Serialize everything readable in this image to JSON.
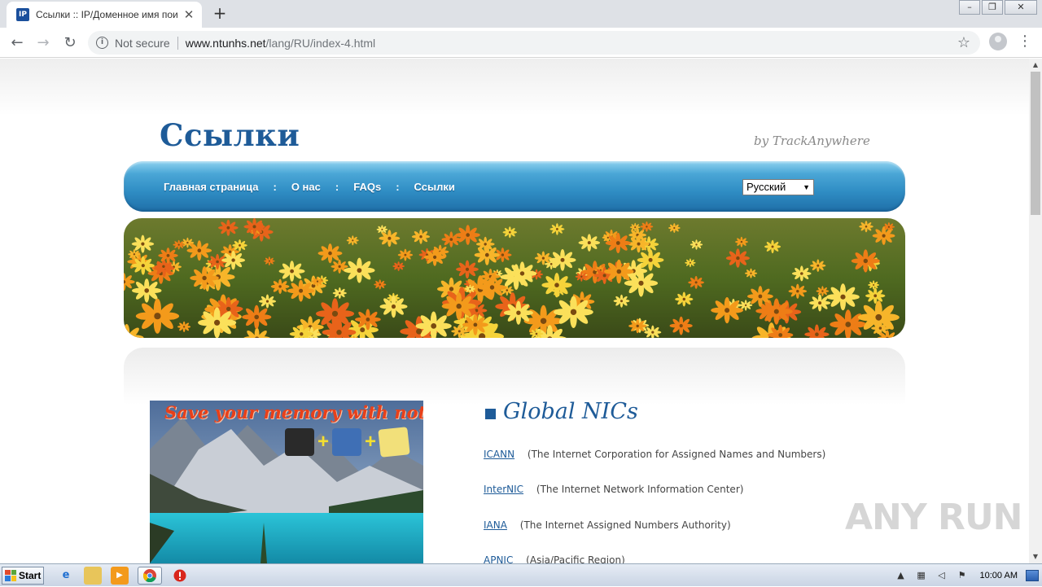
{
  "browser": {
    "tab_title": "Ссылки :: IP/Доменное имя поиска",
    "favicon_text": "IP",
    "url_security": "Not secure",
    "url_host": "www.ntunhs.net",
    "url_path": "/lang/RU/index-4.html"
  },
  "site": {
    "title": "Ссылки",
    "byline": "by TrackAnywhere",
    "nav": [
      "Главная страница",
      "О нас",
      "FAQs",
      "Ссылки"
    ],
    "nav_separator": ":",
    "language_selected": "Русский"
  },
  "promo": {
    "text": "Save your memory with notes",
    "plus": "+"
  },
  "section": {
    "title": "Global NICs",
    "links": [
      {
        "name": "ICANN",
        "desc": "(The Internet Corporation for Assigned Names and Numbers)"
      },
      {
        "name": "InterNIC",
        "desc": "(The Internet Network Information Center)"
      },
      {
        "name": "IANA",
        "desc": "(The Internet Assigned Numbers Authority)"
      },
      {
        "name": "APNIC",
        "desc": "(Asia/Pacific Region)"
      }
    ]
  },
  "watermark": "ANY RUN",
  "taskbar": {
    "start_label": "Start",
    "clock": "10:00 AM"
  },
  "colors": {
    "brand_blue": "#1e5b98",
    "nav_blue": "#2f8dc4",
    "promo_red": "#e8401a"
  },
  "icons": [
    "info-icon",
    "star-icon",
    "profile-icon",
    "menu-icon",
    "back-icon",
    "forward-icon",
    "reload-icon",
    "close-icon",
    "new-tab-icon"
  ]
}
